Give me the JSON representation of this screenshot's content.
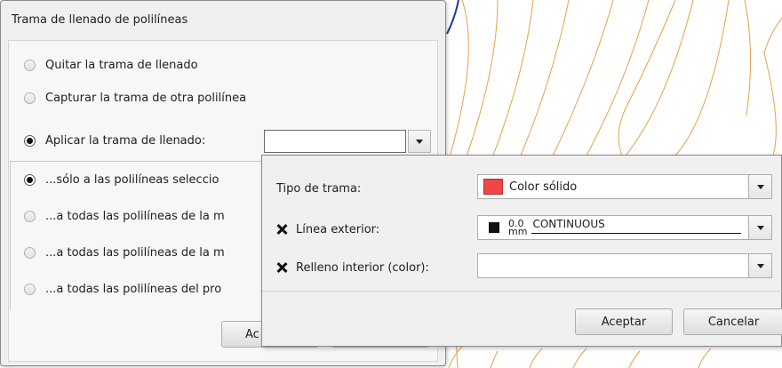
{
  "dialog": {
    "title": "Trama de llenado de polilíneas",
    "options": [
      {
        "label": "Quitar la trama de llenado",
        "selected": false
      },
      {
        "label": "Capturar la trama de otra polilínea",
        "selected": false
      },
      {
        "label": "Aplicar la trama de llenado:",
        "selected": true
      }
    ],
    "scope_options": [
      {
        "label": "...sólo a las polilíneas seleccio",
        "selected": true
      },
      {
        "label": "...a todas las polilíneas de la m",
        "selected": false
      },
      {
        "label": "...a todas las polilíneas de la m",
        "selected": false
      },
      {
        "label": "...a todas las polilíneas del pro",
        "selected": false
      }
    ],
    "accept_button_partial": "Ac"
  },
  "popup": {
    "pattern_type_label": "Tipo de trama:",
    "pattern_type_value": "Color sólido",
    "outline_label": "Línea exterior:",
    "outline_weight": "0.0",
    "outline_weight_unit": "mm",
    "outline_linetype": "CONTINUOUS",
    "fill_label": "Relleno interior (color):",
    "fill_value": "",
    "accept_label": "Aceptar",
    "cancel_label": "Cancelar"
  },
  "colors": {
    "solid_swatch": "#f04646",
    "contour_lines": "#e3a24a",
    "boundary_line": "#2233aa"
  }
}
